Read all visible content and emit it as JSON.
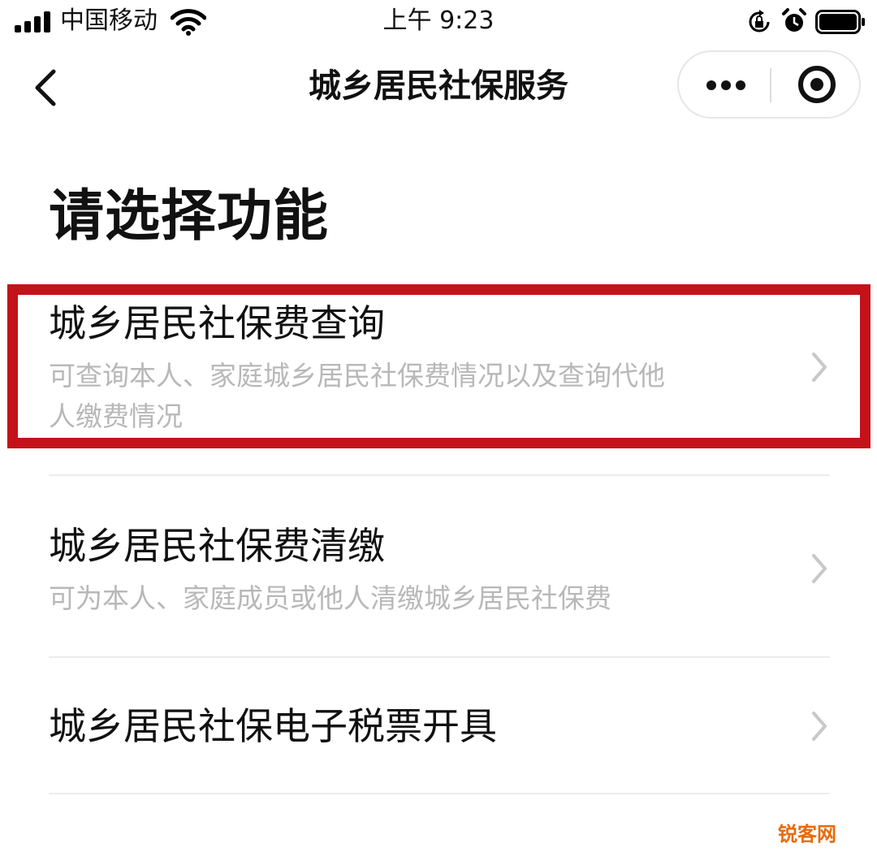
{
  "status_bar": {
    "carrier": "中国移动",
    "time": "上午 9:23"
  },
  "nav": {
    "title": "城乡居民社保服务"
  },
  "heading": "请选择功能",
  "options": [
    {
      "title": "城乡居民社保费查询",
      "description_lines": [
        "可查询本人、家庭城乡居民社保费情况以及查询代他",
        "人缴费情况"
      ]
    },
    {
      "title": "城乡居民社保费清缴",
      "description_lines": [
        "可为本人、家庭成员或他人清缴城乡居民社保费"
      ]
    },
    {
      "title": "城乡居民社保电子税票开具",
      "description_lines": []
    }
  ],
  "highlight_color": "#c4121a",
  "watermark": "锐客网"
}
